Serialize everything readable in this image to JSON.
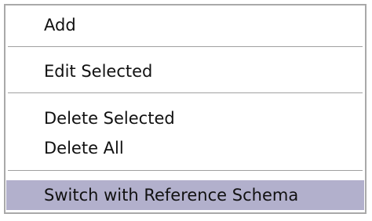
{
  "context_menu": {
    "items": [
      {
        "label": "Add"
      },
      {
        "label": "Edit Selected"
      },
      {
        "label": "Delete Selected"
      },
      {
        "label": "Delete All"
      },
      {
        "label": "Switch with Reference Schema",
        "highlighted": true
      }
    ],
    "highlight_color": "#b2b0cc"
  }
}
